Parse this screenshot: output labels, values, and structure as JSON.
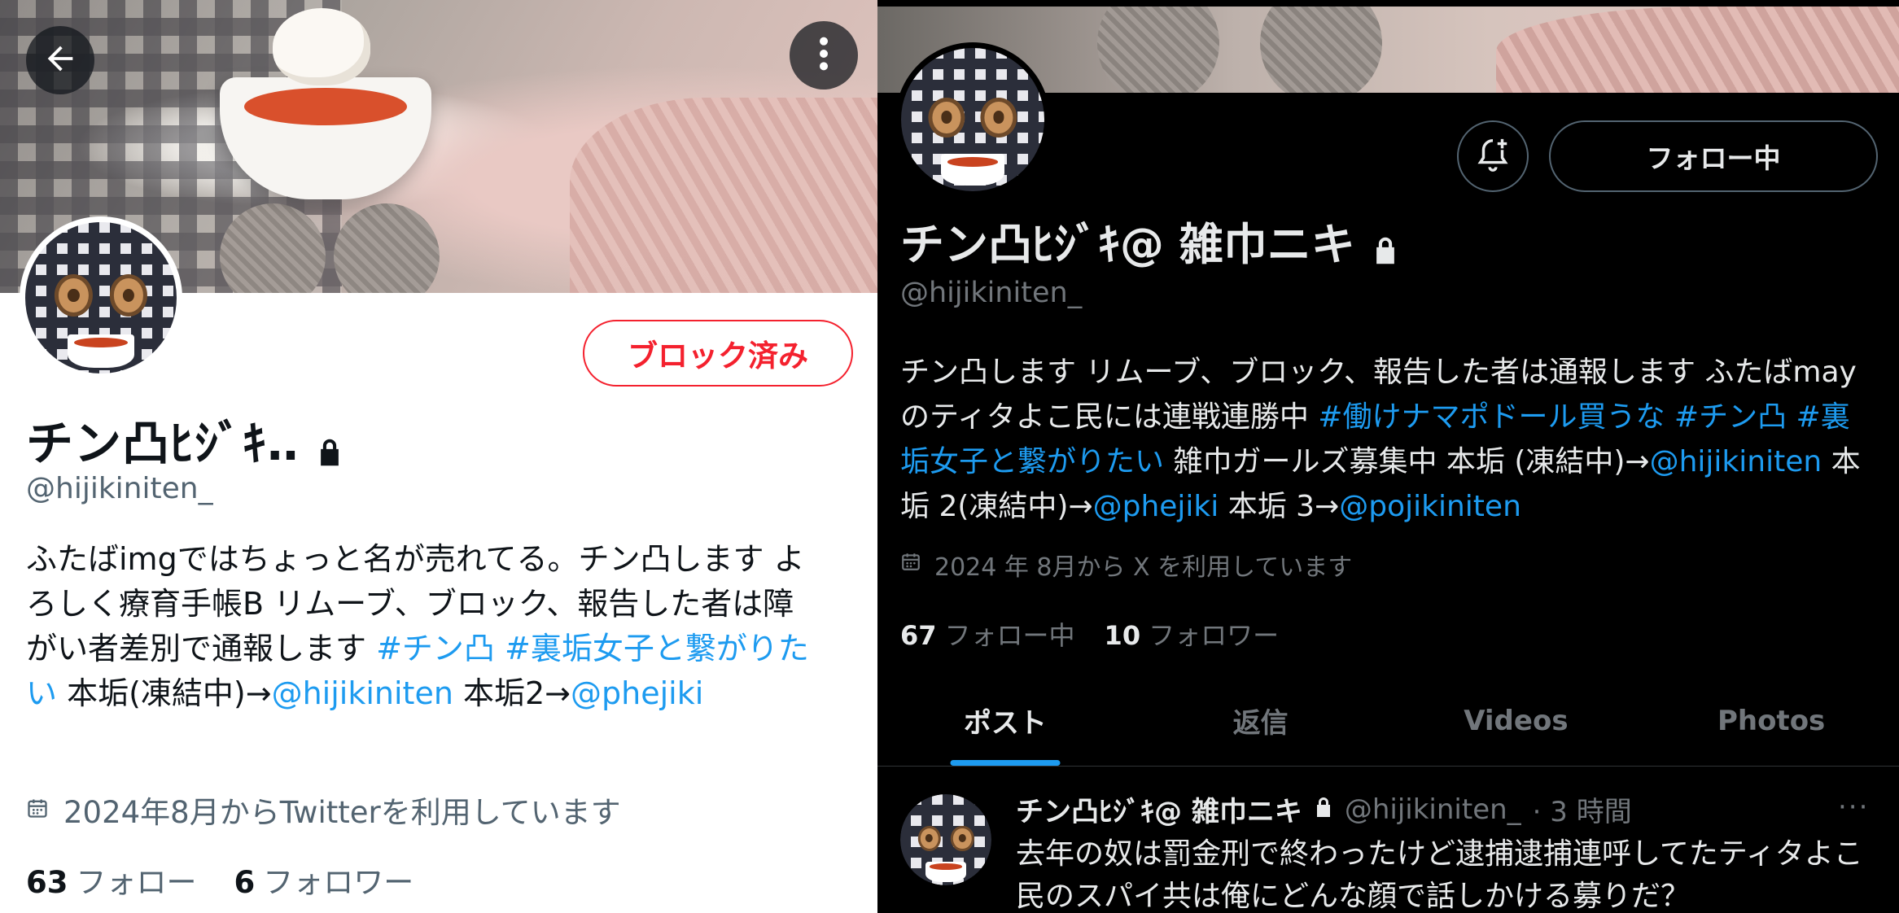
{
  "left": {
    "block_label": "ブロック済み",
    "name": "チン凸ﾋｼﾞｷ‥",
    "handle": "@hijikiniten_",
    "bio": {
      "text1": "ふたばimgではちょっと名が売れてる。チン凸します よろしく療育手帳B リムーブ、ブロック、報告した者は障がい者差別で通報します ",
      "tag1": "#チン凸",
      "space1": " ",
      "tag2": "#裏垢女子と繋がりたい",
      "text2": " 本垢(凍結中)→",
      "mention1": "@hijikiniten",
      "text3": " 本垢2→",
      "mention2": "@phejiki"
    },
    "joined": "2024年8月からTwitterを利用しています",
    "following_count": "63",
    "following_label": "フォロー",
    "followers_count": "6",
    "followers_label": "フォロワー"
  },
  "right": {
    "following_button": "フォロー中",
    "name": "チン凸ﾋｼﾞｷ@ 雑巾ニキ",
    "handle": "@hijikiniten_",
    "bio": {
      "text1": "チン凸します リムーブ、ブロック、報告した者は通報します ふたばmayのティタよこ民には連戦連勝中 ",
      "tag1": "#働けナマポドール買うな",
      "space1": " ",
      "tag2": "#チン凸",
      "space2": " ",
      "tag3": "#裏垢女子と繋がりたい",
      "text2": " 雑巾ガールズ募集中 本垢 (凍結中)→",
      "mention1": "@hijikiniten",
      "text3": " 本垢 2(凍結中)→",
      "mention2": "@phejiki",
      "text4": " 本垢 3→",
      "mention3": "@pojikiniten"
    },
    "joined": "2024 年 8月から X を利用しています",
    "following_count": "67",
    "following_label": "フォロー中",
    "followers_count": "10",
    "followers_label": "フォロワー",
    "tabs": [
      "ポスト",
      "返信",
      "Videos",
      "Photos"
    ],
    "post": {
      "name": "チン凸ﾋｼﾞｷ@ 雑巾ニキ",
      "handle": "@hijikiniten_",
      "time": "· 3 時間",
      "more": "···",
      "text": "去年の奴は罰金刑で終わったけど逮捕逮捕連呼してたティタよこ民のスパイ共は俺にどんな顔で話しかける募りだ？"
    }
  },
  "colors": {
    "link": "#1d9bf0",
    "block_red": "#f4212e"
  }
}
